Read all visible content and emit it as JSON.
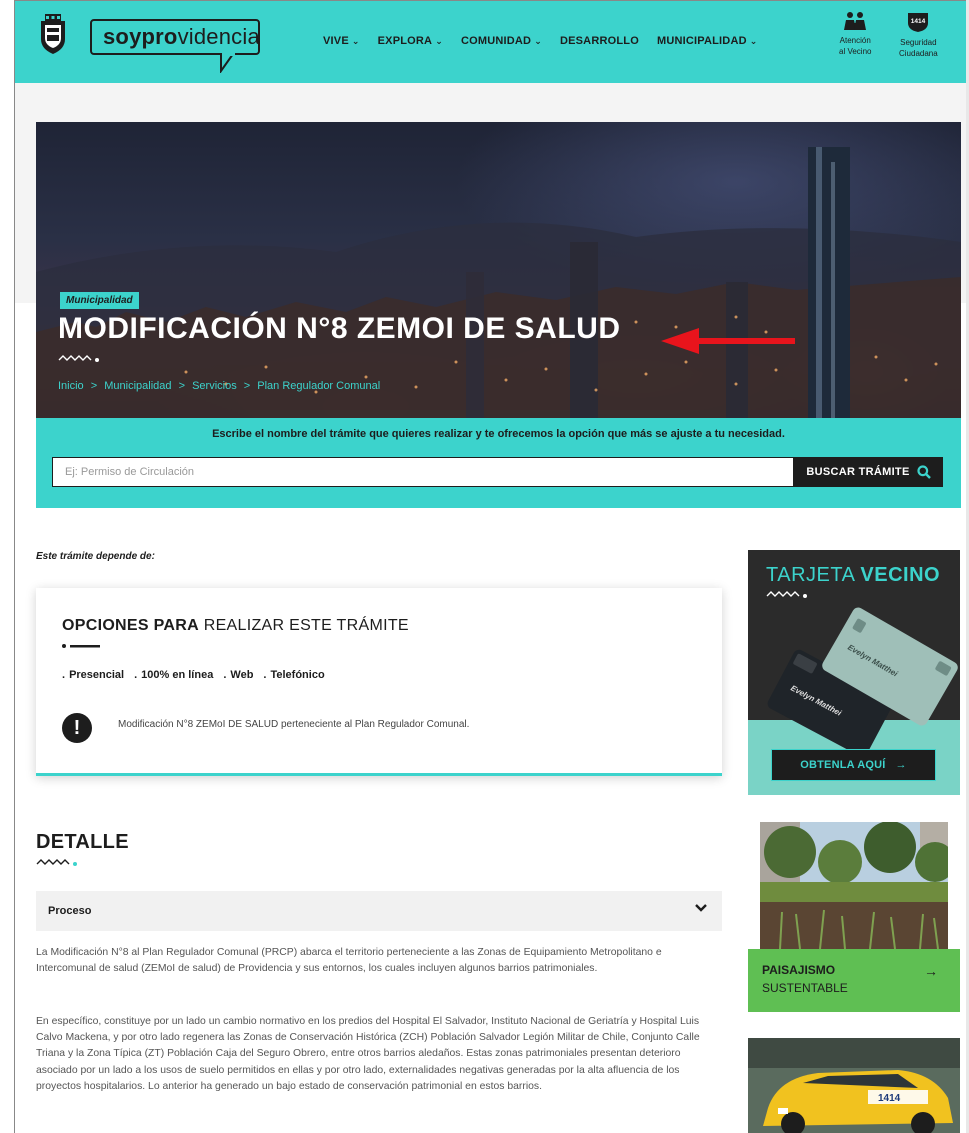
{
  "header": {
    "logo_bold": "soypro",
    "logo_light": "videncia",
    "nav": [
      {
        "label": "VIVE",
        "has_dropdown": true
      },
      {
        "label": "EXPLORA",
        "has_dropdown": true
      },
      {
        "label": "COMUNIDAD",
        "has_dropdown": true
      },
      {
        "label": "DESARROLLO",
        "has_dropdown": false
      },
      {
        "label": "MUNICIPALIDAD",
        "has_dropdown": true
      }
    ],
    "tools": [
      {
        "line1": "Atención",
        "line2": "al Vecino",
        "icon": "people-icon"
      },
      {
        "line1": "Seguridad",
        "line2": "Ciudadana",
        "icon": "shield-1414-icon",
        "badge": "1414"
      }
    ],
    "chevron": "⌄"
  },
  "hero": {
    "badge": "Municipalidad",
    "title": "MODIFICACIÓN N°8 ZEMOI DE SALUD",
    "breadcrumb": [
      "Inicio",
      ">",
      "Municipalidad",
      ">",
      "Servicios",
      ">",
      "Plan Regulador Comunal"
    ]
  },
  "search": {
    "hint": "Escribe el nombre del trámite que quieres realizar y te ofrecemos la opción que más se ajuste a tu necesidad.",
    "placeholder": "Ej: Permiso de Circulación",
    "button_label": "BUSCAR TRÁMITE"
  },
  "depends_label": "Este trámite depende de:",
  "options_card": {
    "title_bold": "OPCIONES PARA",
    "title_light": " REALIZAR ESTE TRÁMITE",
    "modes": [
      "Presencial",
      "100% en línea",
      "Web",
      "Telefónico"
    ],
    "notice": "Modificación N°8 ZEMoI DE SALUD perteneciente al Plan Regulador Comunal."
  },
  "detalle": {
    "title": "DETALLE",
    "accordion_label": "Proceso",
    "paragraphs": [
      "La Modificación N°8 al Plan Regulador Comunal (PRCP) abarca el territorio perteneciente a las Zonas de Equipamiento Metropolitano e Intercomunal de salud (ZEMoI de salud) de Providencia y sus entornos, los cuales incluyen algunos barrios patrimoniales.",
      "En específico, constituye por un lado un cambio normativo en los predios del Hospital El Salvador, Instituto Nacional de Geriatría y Hospital Luis Calvo Mackena, y por otro lado regenera las Zonas de Conservación Histórica (ZCH) Población Salvador Legión Militar de Chile, Conjunto Calle Triana y la Zona Típica (ZT) Población Caja del Seguro Obrero, entre otros barrios aledaños. Estas zonas patrimoniales presentan deterioro asociado por un lado a los usos de suelo permitidos en ellas y por otro lado, externalidades negativas generadas por la alta afluencia de los proyectos hospitalarios. Lo anterior ha generado un bajo estado de conservación patrimonial en estos barrios."
    ]
  },
  "sidebar": {
    "tarjeta_light": "TARJETA",
    "tarjeta_bold": "VECINO",
    "card_name": "Evelyn Matthei",
    "tarjeta_button": "OBTENLA AQUÍ",
    "paisajismo_title": "PAISAJISMO",
    "paisajismo_sub": "SUSTENTABLE",
    "taxi_badge": "1414"
  },
  "colors": {
    "brand_teal": "#3cd3cc",
    "dark": "#1d1d1d",
    "green": "#5fbf53",
    "annotation_red": "#e8141c"
  }
}
